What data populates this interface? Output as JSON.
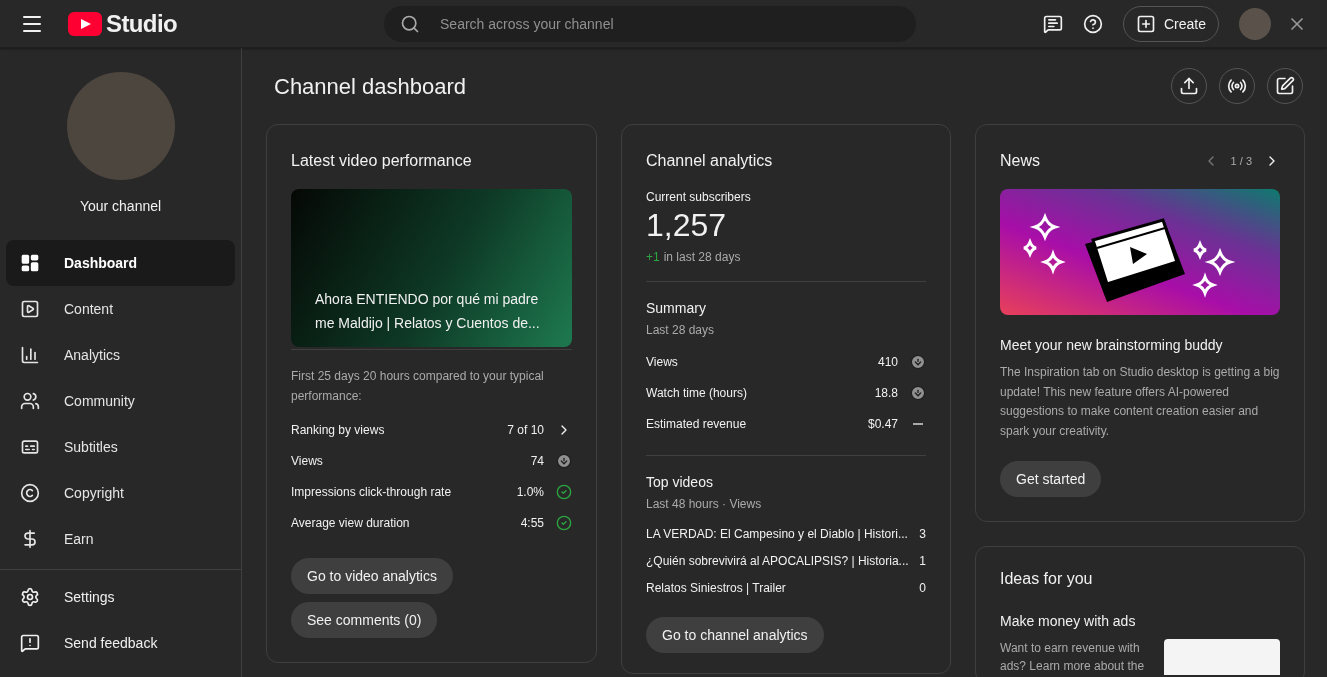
{
  "header": {
    "logo_text": "Studio",
    "search": {
      "placeholder": "Search across your channel"
    },
    "create_button": "Create"
  },
  "sidebar": {
    "channel_label": "Your channel",
    "items": [
      {
        "label": "Dashboard",
        "selected": true
      },
      {
        "label": "Content",
        "selected": false
      },
      {
        "label": "Analytics",
        "selected": false
      },
      {
        "label": "Community",
        "selected": false
      },
      {
        "label": "Subtitles",
        "selected": false
      },
      {
        "label": "Copyright",
        "selected": false
      },
      {
        "label": "Earn",
        "selected": false
      }
    ],
    "footer_items": [
      {
        "label": "Settings"
      },
      {
        "label": "Send feedback"
      }
    ]
  },
  "page": {
    "title": "Channel dashboard"
  },
  "latest_video": {
    "title": "Latest video performance",
    "video_title": "Ahora ENTIENDO por qué mi padre me Maldijo | Relatos y Cuentos de...",
    "comparison_note": "First 25 days 20 hours compared to your typical performance:",
    "metrics": [
      {
        "label": "Ranking by views",
        "value": "7 of 10",
        "kind": "more"
      },
      {
        "label": "Views",
        "value": "74",
        "kind": "down"
      },
      {
        "label": "Impressions click-through rate",
        "value": "1.0%",
        "kind": "good"
      },
      {
        "label": "Average view duration",
        "value": "4:55",
        "kind": "good"
      }
    ],
    "buttons": [
      "Go to video analytics",
      "See comments (0)"
    ]
  },
  "channel_analytics": {
    "title": "Channel analytics",
    "subscribers_label": "Current subscribers",
    "subscribers": "1,257",
    "change": "+1",
    "change_label": "in last 28 days",
    "summary": {
      "title": "Summary",
      "period": "Last 28 days",
      "rows": [
        {
          "label": "Views",
          "value": "410",
          "kind": "down"
        },
        {
          "label": "Watch time (hours)",
          "value": "18.8",
          "kind": "down"
        },
        {
          "label": "Estimated revenue",
          "value": "$0.47",
          "kind": "neutral"
        }
      ]
    },
    "top_videos": {
      "title": "Top videos",
      "period": "Last 48 hours · Views",
      "rows": [
        {
          "title": "LA VERDAD: El Campesino y el Diablo | Histori...",
          "views": "3"
        },
        {
          "title": "¿Quién sobrevivirá al APOCALIPSIS? | Historia...",
          "views": "1"
        },
        {
          "title": "Relatos Siniestros | Trailer",
          "views": "0"
        }
      ]
    },
    "button": "Go to channel analytics"
  },
  "news": {
    "title": "News",
    "pager": "1 / 3",
    "headline": "Meet your new brainstorming buddy",
    "body": "The Inspiration tab on Studio desktop is getting a big update! This new feature offers AI-powered suggestions to make content creation easier and spark your creativity.",
    "button": "Get started"
  },
  "ideas": {
    "title": "Ideas for you",
    "headline": "Make money with ads",
    "body": "Want to earn revenue with ads? Learn more about the"
  }
}
